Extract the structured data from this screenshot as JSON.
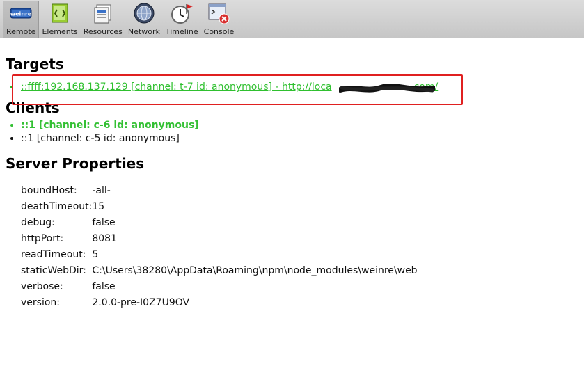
{
  "toolbar": {
    "items": [
      {
        "label": "Remote",
        "icon": "weinre-logo-icon"
      },
      {
        "label": "Elements",
        "icon": "elements-icon"
      },
      {
        "label": "Resources",
        "icon": "resources-icon"
      },
      {
        "label": "Network",
        "icon": "network-icon"
      },
      {
        "label": "Timeline",
        "icon": "timeline-icon"
      },
      {
        "label": "Console",
        "icon": "console-icon"
      }
    ],
    "logo_text": "weinre"
  },
  "targets": {
    "heading": "Targets",
    "items": [
      {
        "text": "::ffff:192.168.137.129 [channel: t-7 id: anonymous] - http://",
        "text_suffix": "loca",
        "text_end": "com/"
      }
    ]
  },
  "clients": {
    "heading": "Clients",
    "items": [
      {
        "text": "::1 [channel: c-6 id: anonymous]",
        "active": true
      },
      {
        "text": "::1 [channel: c-5 id: anonymous]",
        "active": false
      }
    ]
  },
  "server": {
    "heading": "Server Properties",
    "props": [
      {
        "key": "boundHost:",
        "value": "-all-"
      },
      {
        "key": "deathTimeout:",
        "value": "15"
      },
      {
        "key": "debug:",
        "value": "false"
      },
      {
        "key": "httpPort:",
        "value": "8081"
      },
      {
        "key": "readTimeout:",
        "value": "5"
      },
      {
        "key": "staticWebDir:",
        "value": "C:\\Users\\38280\\AppData\\Roaming\\npm\\node_modules\\weinre\\web"
      },
      {
        "key": "verbose:",
        "value": "false"
      },
      {
        "key": "version:",
        "value": "2.0.0-pre-I0Z7U9OV"
      }
    ]
  },
  "colors": {
    "highlight_box": "#e02020",
    "active_green": "#2fc02f"
  }
}
